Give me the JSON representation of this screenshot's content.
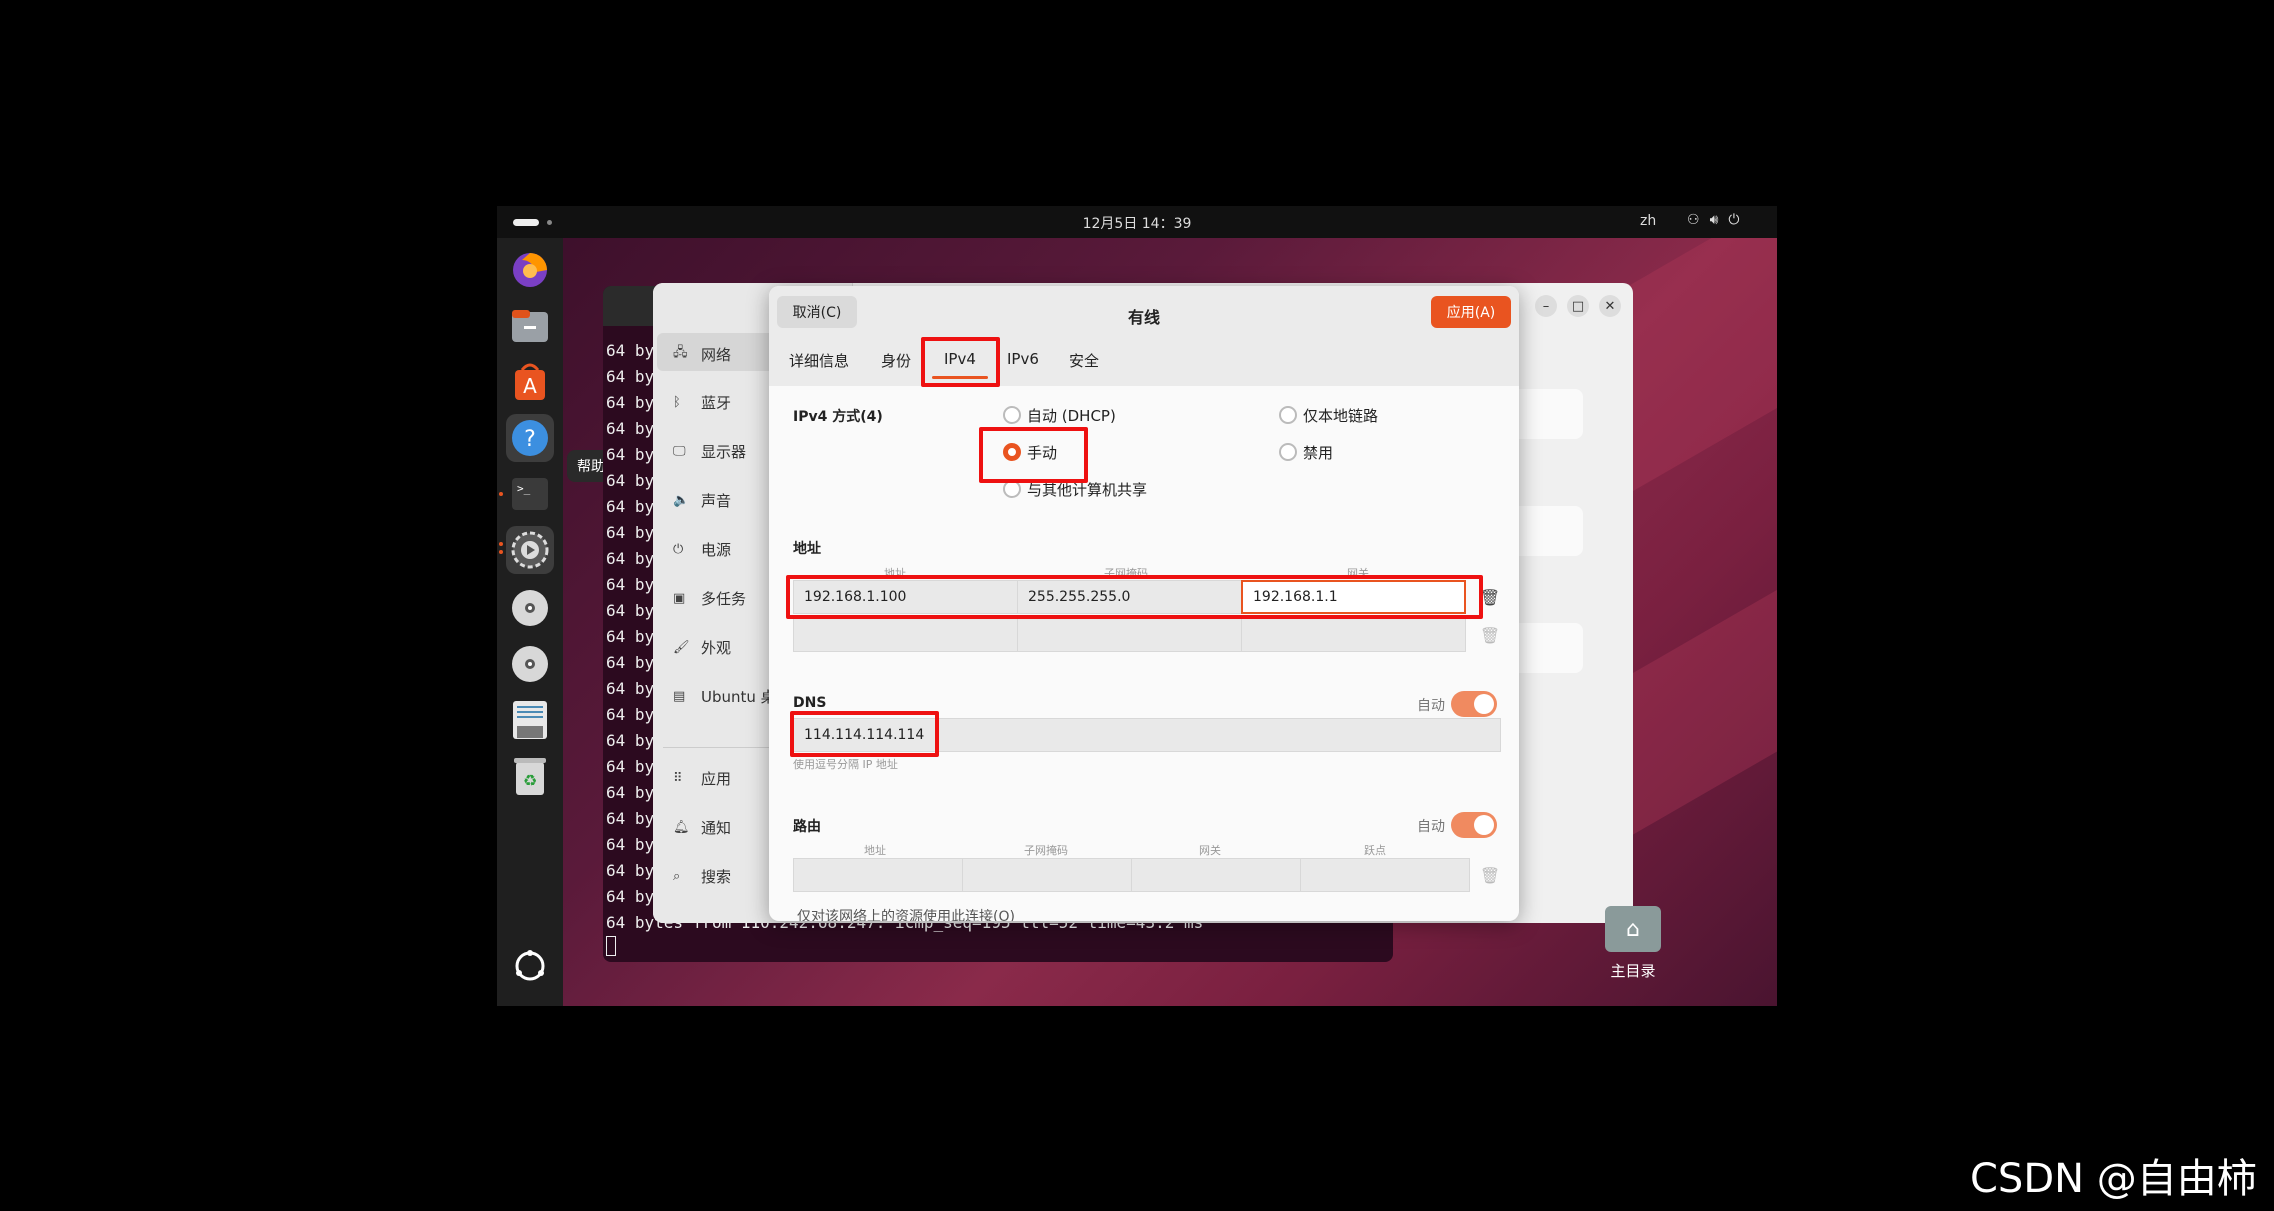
{
  "topbar": {
    "clock": "12月5日 14：39",
    "lang": "zh"
  },
  "dock": {
    "tooltip": "帮助"
  },
  "terminal": {
    "lines": [
      "64 by",
      "64 by",
      "64 by",
      "64 by",
      "64 by",
      "64 by",
      "64 by",
      "64 by",
      "64 by",
      "64 by",
      "64 by",
      "64 by",
      "64 by",
      "64 by",
      "64 by",
      "64 by",
      "64 by",
      "64 by",
      "64 by",
      "64 by",
      "64 by",
      "64 by",
      "64 bytes from 110.242.68.247: icmp_seq=195 ttl=52 time=43.2 ms"
    ]
  },
  "settings_sidebar": {
    "items": [
      {
        "icon": "network-icon",
        "label": "网络"
      },
      {
        "icon": "bluetooth-icon",
        "label": "蓝牙"
      },
      {
        "icon": "display-icon",
        "label": "显示器"
      },
      {
        "icon": "sound-icon",
        "label": "声音"
      },
      {
        "icon": "power-icon",
        "label": "电源"
      },
      {
        "icon": "multitasking-icon",
        "label": "多任务"
      },
      {
        "icon": "appearance-icon",
        "label": "外观"
      },
      {
        "icon": "ubuntu-desktop-icon",
        "label": "Ubuntu 桌"
      },
      {
        "icon": "apps-icon",
        "label": "应用"
      },
      {
        "icon": "bell-icon",
        "label": "通知"
      },
      {
        "icon": "search-icon",
        "label": "搜索"
      }
    ]
  },
  "dialog": {
    "title": "有线",
    "cancel": "取消(C)",
    "apply": "应用(A)",
    "tabs": [
      "详细信息",
      "身份",
      "IPv4",
      "IPv6",
      "安全"
    ],
    "active_tab": "IPv4",
    "method_label": "IPv4 方式(4)",
    "methods": {
      "auto": "自动 (DHCP)",
      "link_local": "仅本地链路",
      "manual": "手动",
      "disabled": "禁用",
      "shared": "与其他计算机共享"
    },
    "selected_method": "手动",
    "address_section": "地址",
    "address_headers": [
      "地址",
      "子网掩码",
      "网关"
    ],
    "address_row": {
      "address": "192.168.1.100",
      "netmask": "255.255.255.0",
      "gateway": "192.168.1.1"
    },
    "dns_section": "DNS",
    "dns_auto_label": "自动",
    "dns_value": "114.114.114.114",
    "dns_hint": "使用逗号分隔 IP 地址",
    "route_section": "路由",
    "route_auto_label": "自动",
    "route_headers": [
      "地址",
      "子网掩码",
      "网关",
      "跃点"
    ],
    "route_only_label": "仅对该网络上的资源使用此连接(O)"
  },
  "desktop": {
    "home_label": "主目录"
  },
  "watermark": "CSDN @自由柿",
  "colors": {
    "accent": "#e95420",
    "highlight": "#ee1111"
  }
}
